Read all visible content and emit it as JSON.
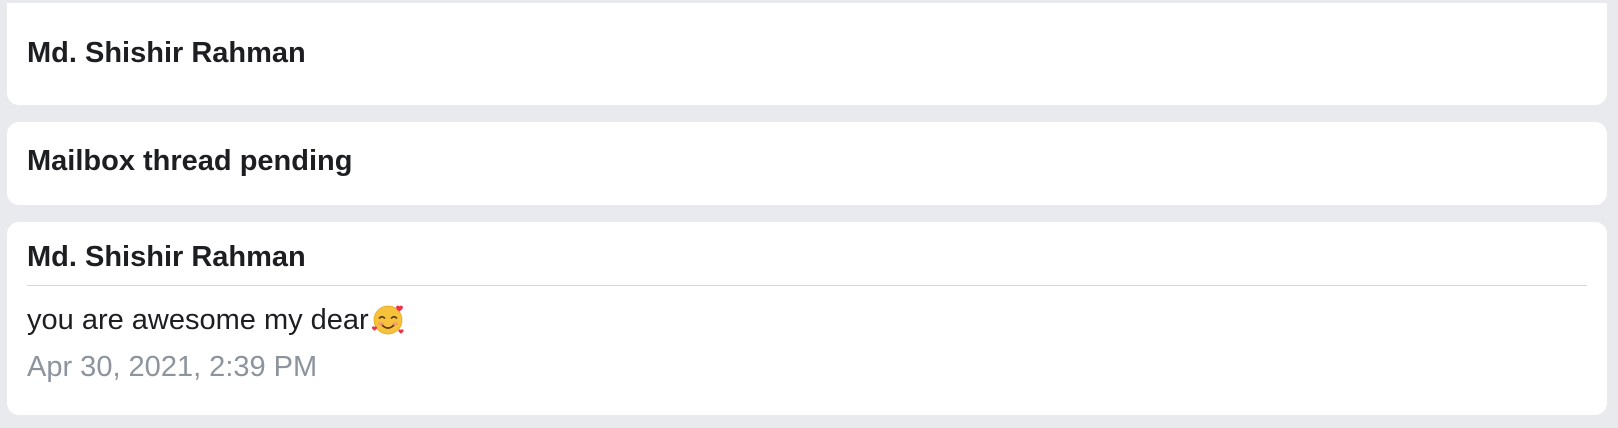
{
  "header_card": {
    "sender_name": "Md. Shishir Rahman"
  },
  "thread_status": {
    "label": "Mailbox thread pending"
  },
  "message_card": {
    "sender_name": "Md. Shishir Rahman",
    "text": "you are awesome my dear",
    "emoji": "smiling-face-with-hearts-icon",
    "timestamp": "Apr 30, 2021, 2:39 PM"
  },
  "colors": {
    "page_background": "#e9eaed",
    "card_background": "#ffffff",
    "primary_text": "#1c1e21",
    "secondary_text": "#8d949e",
    "divider": "#d3d5d9"
  }
}
